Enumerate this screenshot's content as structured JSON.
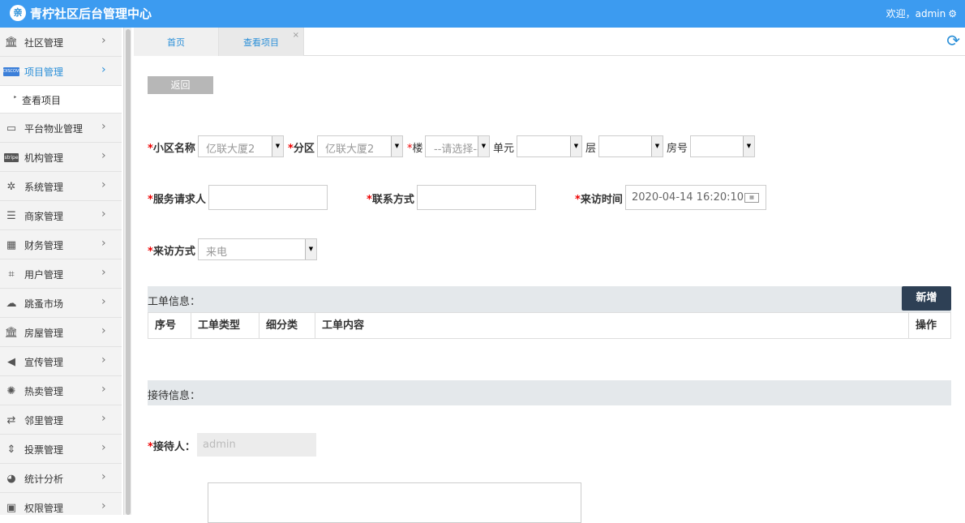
{
  "header": {
    "title": "青柠社区后台管理中心",
    "logo_glyph": "亲",
    "welcome": "欢迎，admin",
    "welcome_icon": "gear-icon",
    "bg": "#3c9bf0"
  },
  "sidebar": {
    "items": [
      {
        "label": "社区管理",
        "icon": "bank-icon"
      },
      {
        "label": "项目管理",
        "icon": "card-icon",
        "active": true
      },
      {
        "label": "平台物业管理",
        "icon": "monitor-icon"
      },
      {
        "label": "机构管理",
        "icon": "stripe-icon"
      },
      {
        "label": "系统管理",
        "icon": "yelp-icon"
      },
      {
        "label": "商家管理",
        "icon": "menu-icon"
      },
      {
        "label": "财务管理",
        "icon": "calculator-icon"
      },
      {
        "label": "用户管理",
        "icon": "crop-icon"
      },
      {
        "label": "跳蚤市场",
        "icon": "cloud-icon"
      },
      {
        "label": "房屋管理",
        "icon": "bank-icon"
      },
      {
        "label": "宣传管理",
        "icon": "volume-icon"
      },
      {
        "label": "热卖管理",
        "icon": "sun-icon"
      },
      {
        "label": "邻里管理",
        "icon": "retweet-icon"
      },
      {
        "label": "投票管理",
        "icon": "sort-icon"
      },
      {
        "label": "统计分析",
        "icon": "pie-chart-icon"
      },
      {
        "label": "权限管理",
        "icon": "window-icon"
      }
    ],
    "sub_item": "查看项目",
    "chevron": "›",
    "sub_marker": "‣",
    "stripe_text": "stripe",
    "card_text": "DISCOVER"
  },
  "tabs": [
    {
      "label": "首页"
    },
    {
      "label": "查看项目",
      "close": "×"
    }
  ],
  "refresh_icon": "⟳",
  "form": {
    "back_label": "返回",
    "community_label": "小区名称",
    "community_value": "亿联大厦2",
    "district_label": "分区",
    "district_value": "亿联大厦2",
    "building_label": "楼",
    "building_value": "--请选择--",
    "unit_label": "单元",
    "floor_label": "层",
    "room_label": "房号",
    "requester_label": "服务请求人",
    "contact_label": "联系方式",
    "visit_time_label": "来访时间",
    "visit_time_value": "2020-04-14 16:20:10",
    "visit_method_label": "来访方式",
    "visit_method_value": "来电",
    "required_mark": "*",
    "arrow": "▼"
  },
  "work_order": {
    "title": "工单信息：",
    "add_label": "新增",
    "columns": [
      "序号",
      "工单类型",
      "细分类",
      "工单内容",
      "操作"
    ]
  },
  "reception": {
    "title": "接待信息：",
    "receiver_label": "接待人：",
    "receiver_value": "admin"
  }
}
